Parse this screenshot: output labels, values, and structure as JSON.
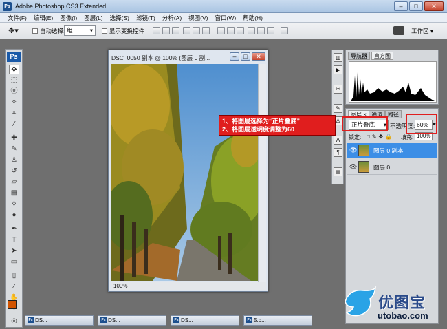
{
  "window": {
    "title": "Adobe Photoshop CS3 Extended",
    "app_icon": "Ps",
    "controls": [
      "–",
      "□",
      "✕"
    ]
  },
  "menu": [
    "文件(F)",
    "编辑(E)",
    "图像(I)",
    "图层(L)",
    "选择(S)",
    "滤镜(T)",
    "分析(A)",
    "视图(V)",
    "窗口(W)",
    "帮助(H)"
  ],
  "options": {
    "auto_select_label": "自动选择:",
    "auto_select_value": "组",
    "show_transform_label": "显示变换控件",
    "workspace_label": "工作区 ▾"
  },
  "toolbox": {
    "logo": "Ps"
  },
  "document": {
    "title": "DSC_0050 副本 @ 100% (图层 0 副...",
    "zoom": "100%"
  },
  "navigator": {
    "tabs": [
      "导航器",
      "直方图"
    ]
  },
  "layers": {
    "tabs": [
      "图层 ×",
      "通道",
      "路径"
    ],
    "blend_mode": "正片叠底",
    "opacity_label": "不透明度:",
    "opacity_value": "60%",
    "lock_label": "锁定:",
    "fill_label": "填充:",
    "fill_value": "100%",
    "items": [
      {
        "name": "图层 0 副本",
        "selected": true
      },
      {
        "name": "图层 0",
        "selected": false
      }
    ]
  },
  "callout": {
    "line1": "1、将图层选择为“正片叠底”",
    "line2": "2、将图层透明度调整为60"
  },
  "doc_tabs": [
    "DS...",
    "DS...",
    "DS...",
    "5.p..."
  ],
  "watermark": {
    "cn": "优图宝",
    "url": "utobao.com"
  },
  "colors": {
    "accent_selected": "#3c8ee6",
    "callout": "#e01e1e",
    "ps_blue": "#1a5aa8"
  }
}
